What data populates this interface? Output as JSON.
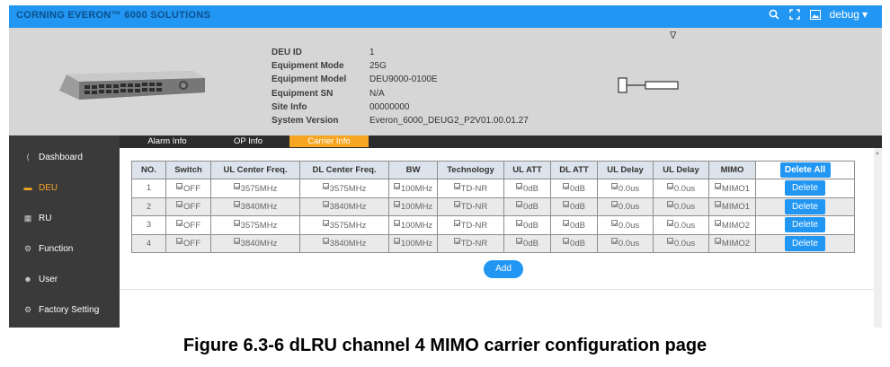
{
  "header": {
    "brand": "CORNING EVERON™ 6000 SOLUTIONS",
    "user": "debug",
    "icons": [
      "search-icon",
      "fullscreen-icon",
      "image-icon",
      "caret-down-icon"
    ]
  },
  "device": {
    "fields": [
      {
        "label": "DEU ID",
        "value": "1"
      },
      {
        "label": "Equipment Mode",
        "value": "25G"
      },
      {
        "label": "Equipment Model",
        "value": "DEU9000-0100E"
      },
      {
        "label": "Equipment SN",
        "value": "N/A"
      },
      {
        "label": "Site Info",
        "value": "00000000"
      },
      {
        "label": "System Version",
        "value": "Everon_6000_DEUG2_P2V01.00.01.27"
      }
    ]
  },
  "sidebar": {
    "items": [
      {
        "label": "Dashboard",
        "icon": "share-icon"
      },
      {
        "label": "DEU",
        "icon": "monitor-icon",
        "active": true
      },
      {
        "label": "RU",
        "icon": "grid-icon"
      },
      {
        "label": "Function",
        "icon": "gear-icon"
      },
      {
        "label": "User",
        "icon": "user-icon"
      },
      {
        "label": "Factory Setting",
        "icon": "factory-gear-icon"
      }
    ]
  },
  "tabs": [
    {
      "label": "Alarm Info"
    },
    {
      "label": "OP Info"
    },
    {
      "label": "Carrier Info",
      "active": true
    }
  ],
  "table": {
    "headers": [
      "NO.",
      "Switch",
      "UL Center Freq.",
      "DL Center Freq.",
      "BW",
      "Technology",
      "UL ATT",
      "DL ATT",
      "UL Delay",
      "UL Delay",
      "MIMO"
    ],
    "delete_all_label": "Delete All",
    "delete_label": "Delete",
    "rows": [
      [
        "1",
        "OFF",
        "3575MHz",
        "3575MHz",
        "100MHz",
        "TD-NR",
        "0dB",
        "0dB",
        "0.0us",
        "0.0us",
        "MIMO1"
      ],
      [
        "2",
        "OFF",
        "3840MHz",
        "3840MHz",
        "100MHz",
        "TD-NR",
        "0dB",
        "0dB",
        "0.0us",
        "0.0us",
        "MIMO1"
      ],
      [
        "3",
        "OFF",
        "3575MHz",
        "3575MHz",
        "100MHz",
        "TD-NR",
        "0dB",
        "0dB",
        "0.0us",
        "0.0us",
        "MIMO2"
      ],
      [
        "4",
        "OFF",
        "3840MHz",
        "3840MHz",
        "100MHz",
        "TD-NR",
        "0dB",
        "0dB",
        "0.0us",
        "0.0us",
        "MIMO2"
      ]
    ]
  },
  "add_label": "Add",
  "caption": "Figure 6.3-6 dLRU channel 4 MIMO carrier configuration page",
  "colors": {
    "accent": "#2196f3",
    "active": "#f6a623",
    "sidebar": "#3a3a3a"
  }
}
